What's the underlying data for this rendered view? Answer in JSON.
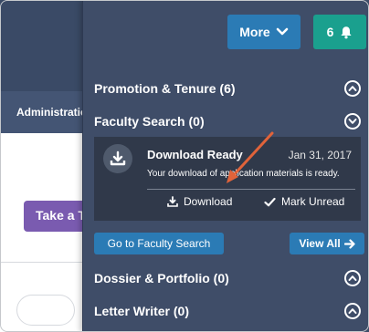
{
  "background": {
    "nav_item": "Administration",
    "purple_button": "Take a To"
  },
  "header": {
    "more_label": "More",
    "notification_count": "6"
  },
  "sections": {
    "promotion_tenure": "Promotion & Tenure (6)",
    "faculty_search": "Faculty Search (0)",
    "dossier_portfolio": "Dossier & Portfolio (0)",
    "letter_writer": "Letter Writer (0)"
  },
  "notification": {
    "title": "Download Ready",
    "date": "Jan 31, 2017",
    "message": "Your download of application materials is ready.",
    "download_label": "Download",
    "mark_unread_label": "Mark Unread"
  },
  "buttons": {
    "go_to_faculty_search": "Go to Faculty Search",
    "view_all": "View All"
  },
  "colors": {
    "panel_bg": "#3f4d68",
    "primary_blue": "#2b7bb5",
    "teal": "#1aa08e",
    "card_bg": "#30394a",
    "annotation_arrow": "#e0633a"
  }
}
